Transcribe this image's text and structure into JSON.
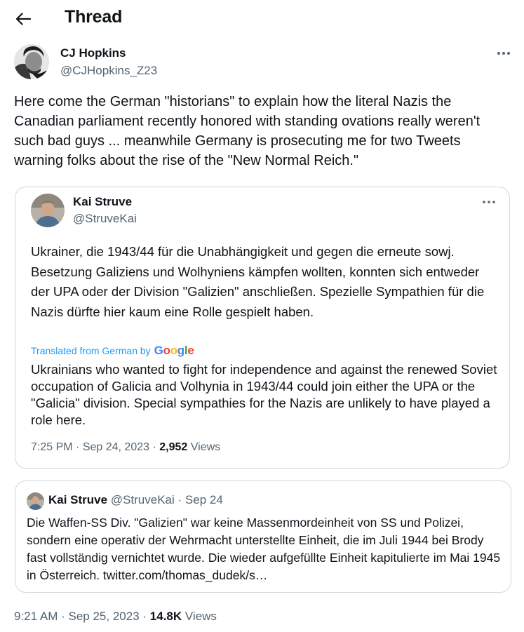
{
  "header": {
    "title": "Thread"
  },
  "tweet": {
    "author_name": "CJ Hopkins",
    "author_handle": "@CJHopkins_Z23",
    "text": "Here come the German \"historians\" to explain how the literal Nazis the Canadian parliament recently honored with standing ovations really weren't such bad guys ... meanwhile Germany is prosecuting me for two Tweets warning folks about the rise of the \"New Normal Reich.\"",
    "time": "9:21 AM",
    "date": "Sep 25, 2023",
    "views": "14.8K",
    "views_label": "Views"
  },
  "quote": {
    "author_name": "Kai Struve",
    "author_handle": "@StruveKai",
    "original_text": "Ukrainer, die 1943/44 für die Unabhängigkeit und gegen die erneute sowj. Besetzung Galiziens und Wolhyniens kämpfen wollten, konnten sich entweder der UPA oder der Division \"Galizien\" anschließen. Spezielle Sympathien für die Nazis dürfte hier kaum eine Rolle gespielt haben.",
    "translated_label": "Translated from German by",
    "translator": "Google",
    "translation": "Ukrainians who wanted to fight for independence and against the renewed Soviet occupation of Galicia and Volhynia in 1943/44 could join either the UPA or the \"Galicia\" division. Special sympathies for the Nazis are unlikely to have played a role here.",
    "time": "7:25 PM",
    "date": "Sep 24, 2023",
    "views": "2,952",
    "views_label": "Views"
  },
  "nested": {
    "author_name": "Kai Struve",
    "author_handle": "@StruveKai",
    "date": "Sep 24",
    "text": "Die Waffen-SS Div. \"Galizien\" war keine Massenmordeinheit von SS und Polizei, sondern eine operativ der Wehrmacht unterstellte Einheit, die im Juli 1944 bei Brody fast vollständig vernichtet wurde. Die wieder aufgefüllte Einheit kapitulierte im Mai 1945 in Österreich. twitter.com/thomas_dudek/s…"
  },
  "colors": {
    "text": "#0f1419",
    "secondary": "#536471",
    "link": "#1d9bf0",
    "border": "#cfd9de"
  },
  "icons": [
    "back-arrow-icon",
    "more-icon",
    "google-logo"
  ]
}
